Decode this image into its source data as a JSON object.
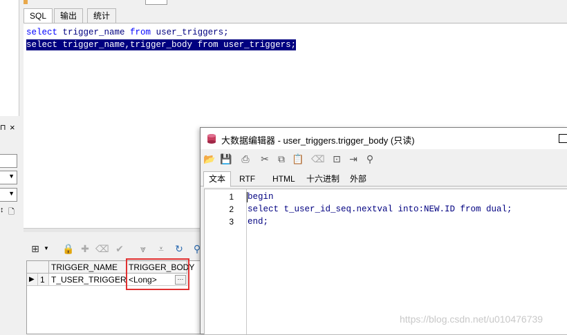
{
  "main_tabs": [
    {
      "label": "SQL"
    },
    {
      "label": "输出"
    },
    {
      "label": "统计"
    }
  ],
  "sql_lines": [
    {
      "kw1": "select",
      "mid": " trigger_name ",
      "kw2": "from",
      "tail": " user_triggers;"
    },
    {
      "kw1": "select",
      "mid": " trigger_name,trigger_body ",
      "kw2": "from",
      "tail": " user_triggers;"
    }
  ],
  "grid": {
    "columns": [
      "TRIGGER_NAME",
      "TRIGGER_BODY"
    ],
    "rows": [
      {
        "num": "1",
        "trigger_name": "T_USER_TRIGGER",
        "trigger_body": "<Long>"
      }
    ],
    "ellipsis": "···"
  },
  "blob_window": {
    "title": "大数据编辑器 - user_triggers.trigger_body (只读)",
    "tabs": [
      "文本",
      "RTF",
      "HTML",
      "十六进制",
      "外部"
    ],
    "line_numbers": [
      "1",
      "2",
      "3"
    ],
    "code_lines": [
      "begin",
      "select t_user_id_seq.nextval into:NEW.ID from dual;",
      "end;"
    ]
  },
  "left_panel": {
    "close_glyph": "×"
  },
  "watermark": "https://blog.csdn.net/u010476739",
  "colors": {
    "selection": "#000080",
    "keyword": "#0000ff",
    "highlight_box": "#e03030"
  }
}
